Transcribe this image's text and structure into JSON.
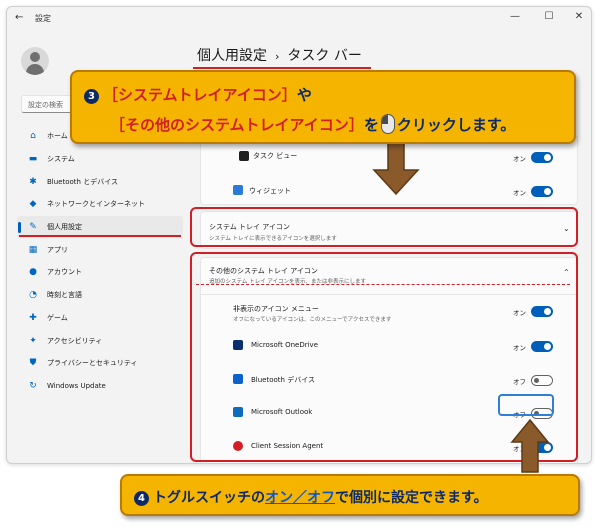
{
  "window": {
    "app_title": "設定",
    "back_glyph": "←",
    "controls": {
      "minimize": "—",
      "maximize": "☐",
      "close": "✕"
    }
  },
  "search": {
    "placeholder": "設定の検索"
  },
  "sidebar": {
    "items": [
      {
        "label": "ホーム",
        "icon": "home-icon",
        "glyph": "⌂"
      },
      {
        "label": "システム",
        "icon": "monitor-icon",
        "glyph": "▬"
      },
      {
        "label": "Bluetooth とデバイス",
        "icon": "bluetooth-icon",
        "glyph": "✱"
      },
      {
        "label": "ネットワークとインターネット",
        "icon": "wifi-icon",
        "glyph": "◆"
      },
      {
        "label": "個人用設定",
        "icon": "brush-icon",
        "glyph": "✎",
        "selected": true
      },
      {
        "label": "アプリ",
        "icon": "apps-icon",
        "glyph": "▦"
      },
      {
        "label": "アカウント",
        "icon": "account-icon",
        "glyph": "●"
      },
      {
        "label": "時刻と言語",
        "icon": "clock-icon",
        "glyph": "◔"
      },
      {
        "label": "ゲーム",
        "icon": "gamepad-icon",
        "glyph": "✚"
      },
      {
        "label": "アクセシビリティ",
        "icon": "accessibility-icon",
        "glyph": "✦"
      },
      {
        "label": "プライバシーとセキュリティ",
        "icon": "shield-icon",
        "glyph": "⛊"
      },
      {
        "label": "Windows Update",
        "icon": "update-icon",
        "glyph": "↻"
      }
    ]
  },
  "breadcrumb": {
    "parent": "個人用設定",
    "separator": "›",
    "current": "タスク バー"
  },
  "taskbar_items": [
    {
      "label": "タスク ビュー",
      "state": "オン",
      "on": true
    },
    {
      "label": "ウィジェット",
      "state": "オン",
      "on": true
    }
  ],
  "system_tray": {
    "title": "システム トレイ アイコン",
    "subtitle": "システム トレイに表示できるアイコンを選択します",
    "chevron": "⌄"
  },
  "other_tray": {
    "title": "その他のシステム トレイ アイコン",
    "subtitle": "追加のシステム トレイ アイコンを表示、または非表示にします",
    "chevron": "⌃",
    "items": [
      {
        "label": "非表示のアイコン メニュー",
        "sub": "オフになっているアイコンは、このメニューでアクセスできます",
        "state": "オン",
        "on": true,
        "icon": ""
      },
      {
        "label": "Microsoft OneDrive",
        "state": "オン",
        "on": true,
        "icon": "onedrive-icon"
      },
      {
        "label": "Bluetooth デバイス",
        "state": "オフ",
        "on": false,
        "icon": "bluetooth-icon"
      },
      {
        "label": "Microsoft Outlook",
        "state": "オフ",
        "on": false,
        "icon": "outlook-icon"
      },
      {
        "label": "Client Session Agent",
        "state": "オン",
        "on": true,
        "icon": "client-agent-icon"
      }
    ]
  },
  "callout_top": {
    "number": "3",
    "line1_red": "［システムトレイアイコン］",
    "line1_tail": "や",
    "line2_red": "［その他のシステムトレイアイコン］",
    "line2_mid": "を",
    "line2_tail": "クリックします。"
  },
  "callout_bottom": {
    "number": "4",
    "pre": "トグルスイッチの",
    "on_word": "オン",
    "slash": "／",
    "off_word": "オフ",
    "post": "で個別に設定できます。"
  },
  "colors": {
    "accent": "#005fb8",
    "annotation_red": "#d21f26",
    "callout_fill": "#f5b400",
    "callout_text": "#0d2a66"
  }
}
